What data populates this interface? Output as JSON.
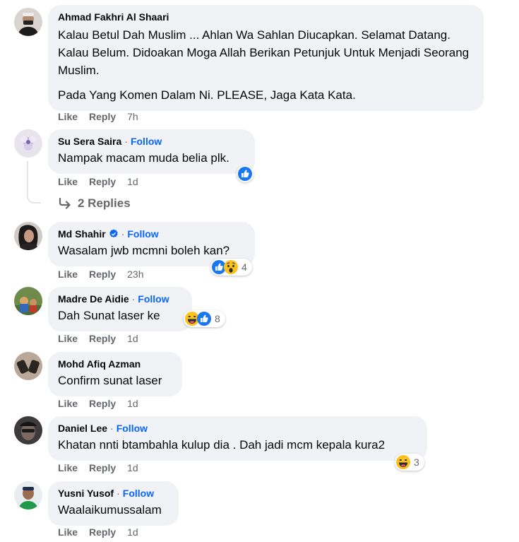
{
  "comments": [
    {
      "author": "Ahmad Fakhri Al Shaari",
      "follow": "",
      "paragraphs": [
        "Kalau Betul Dah Muslim ... Ahlan Wa Sahlan Diucapkan. Selamat Datang. Kalau Belum. Didoakan Moga Allah Berikan Petunjuk Untuk Menjadi Seorang Muslim.",
        "Pada Yang Komen Dalam Ni. PLEASE, Jaga Kata Kata."
      ],
      "like": "Like",
      "reply": "Reply",
      "time": "7h"
    },
    {
      "author": "Su Sera Saira",
      "follow": "Follow",
      "text": "Nampak macam muda belia plk.",
      "like": "Like",
      "reply": "Reply",
      "time": "1d",
      "reactions": [
        "like-icon"
      ],
      "reaction_count": ""
    },
    {
      "author": "Md Shahir",
      "follow": "Follow",
      "verified": true,
      "text": "Wasalam jwb mcmni boleh kan?",
      "like": "Like",
      "reply": "Reply",
      "time": "23h",
      "reactions": [
        "like-icon",
        "wow-icon"
      ],
      "reaction_count": "4"
    },
    {
      "author": "Madre De Aidie",
      "follow": "Follow",
      "text": "Dah Sunat laser ke",
      "like": "Like",
      "reply": "Reply",
      "time": "1d",
      "reactions": [
        "haha-icon",
        "like-icon"
      ],
      "reaction_count": "8"
    },
    {
      "author": "Mohd Afiq Azman",
      "follow": "",
      "text": "Confirm sunat laser",
      "like": "Like",
      "reply": "Reply",
      "time": "1d"
    },
    {
      "author": "Daniel Lee",
      "follow": "Follow",
      "text": "Khatan nnti btambahla kulup dia . Dah jadi mcm kepala kura2",
      "like": "Like",
      "reply": "Reply",
      "time": "1d",
      "reactions": [
        "haha-icon"
      ],
      "reaction_count": "3"
    },
    {
      "author": "Yusni Yusof",
      "follow": "Follow",
      "text": "Waalaikumussalam",
      "like": "Like",
      "reply": "Reply",
      "time": "1d"
    }
  ],
  "replies_link": "2 Replies",
  "separator": "·",
  "colors": {
    "bubble": "#f0f2f5",
    "follow": "#0866ff",
    "meta": "#65676b",
    "text": "#050505"
  }
}
